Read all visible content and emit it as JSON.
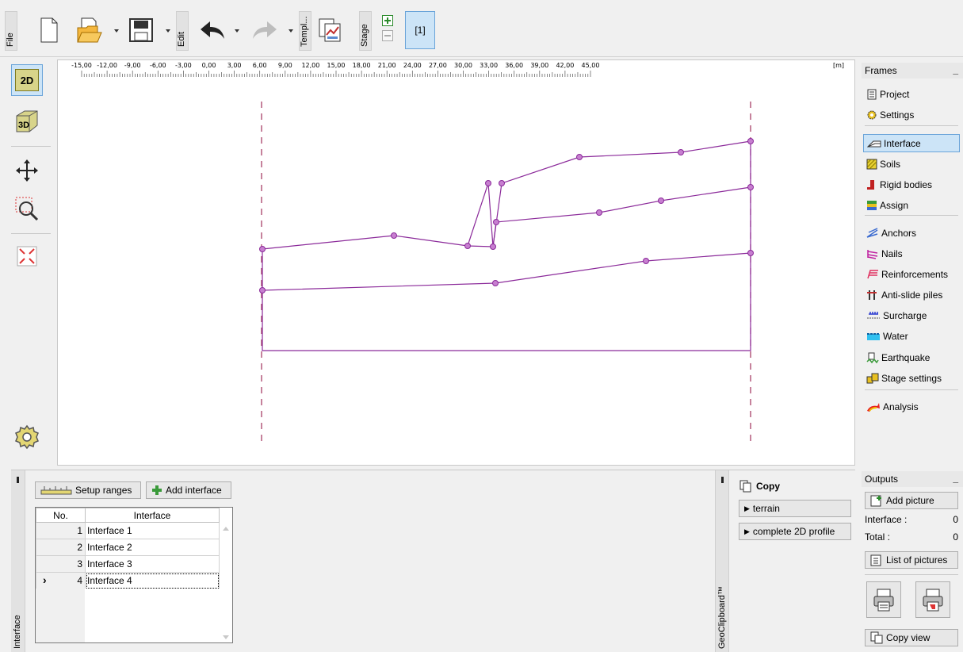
{
  "toolbar": {
    "file_label": "File",
    "edit_label": "Edit",
    "templ_label": "Templ...",
    "stage_label": "Stage",
    "stage_tab": "[1]"
  },
  "left_tools": {
    "view2d": "2D",
    "view3d": "3D"
  },
  "ruler": {
    "ticks": [
      "-15,00",
      "-12,00",
      "-9,00",
      "-6,00",
      "-3,00",
      "0,00",
      "3,00",
      "6,00",
      "9,00",
      "12,00",
      "15,00",
      "18,00",
      "21,00",
      "24,00",
      "27,00",
      "30,00",
      "33,00",
      "36,00",
      "39,00",
      "42,00",
      "45,00"
    ],
    "unit": "[m]"
  },
  "frames": {
    "title": "Frames",
    "items": [
      {
        "label": "Project",
        "icon": "document-icon"
      },
      {
        "label": "Settings",
        "icon": "gear-icon"
      },
      {
        "label": "Interface",
        "icon": "interface-icon",
        "selected": true
      },
      {
        "label": "Soils",
        "icon": "soils-icon"
      },
      {
        "label": "Rigid bodies",
        "icon": "rigid-bodies-icon"
      },
      {
        "label": "Assign",
        "icon": "assign-icon"
      },
      {
        "label": "Anchors",
        "icon": "anchors-icon"
      },
      {
        "label": "Nails",
        "icon": "nails-icon"
      },
      {
        "label": "Reinforcements",
        "icon": "reinforcements-icon"
      },
      {
        "label": "Anti-slide piles",
        "icon": "piles-icon"
      },
      {
        "label": "Surcharge",
        "icon": "surcharge-icon"
      },
      {
        "label": "Water",
        "icon": "water-icon"
      },
      {
        "label": "Earthquake",
        "icon": "earthquake-icon"
      },
      {
        "label": "Stage settings",
        "icon": "stage-settings-icon"
      },
      {
        "label": "Analysis",
        "icon": "analysis-icon"
      }
    ]
  },
  "bottom": {
    "side_label": "Interface",
    "setup_ranges": "Setup ranges",
    "add_interface": "Add interface",
    "table": {
      "headers": [
        "No.",
        "Interface"
      ],
      "rows": [
        {
          "no": "1",
          "name": "Interface 1"
        },
        {
          "no": "2",
          "name": "Interface 2"
        },
        {
          "no": "3",
          "name": "Interface 3"
        },
        {
          "no": "4",
          "name": "Interface 4",
          "current": true
        }
      ]
    },
    "clipboard_label": "GeoClipboard™",
    "copy_title": "Copy",
    "copy_terrain": "terrain",
    "copy_profile": "complete 2D profile"
  },
  "outputs": {
    "title": "Outputs",
    "add_picture": "Add picture",
    "interface_label": "Interface :",
    "interface_count": "0",
    "total_label": "Total :",
    "total_count": "0",
    "list_pictures": "List of pictures",
    "copy_view": "Copy view"
  },
  "colors": {
    "profile_line": "#8b2a9a",
    "node_fill": "#c77fd0",
    "boundary_dash": "#a0305a",
    "selected_bg": "#cce4f7"
  }
}
